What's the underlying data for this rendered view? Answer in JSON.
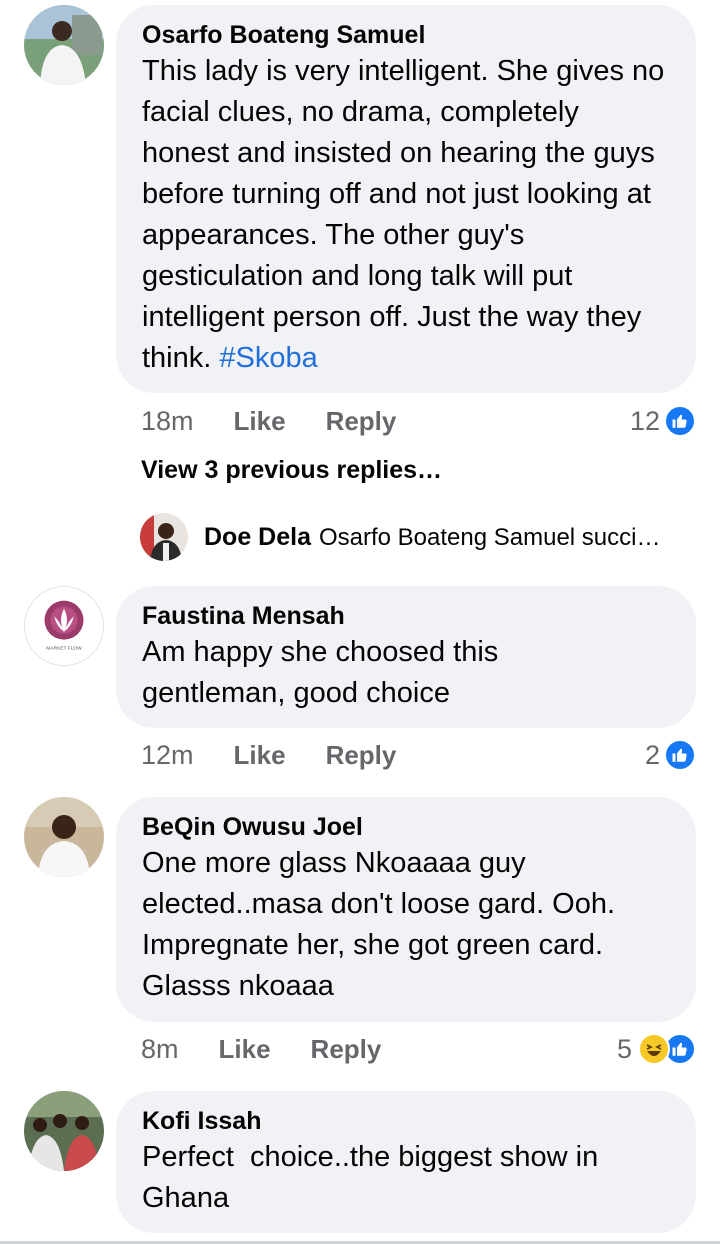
{
  "comments": [
    {
      "author": "Osarfo Boateng Samuel",
      "text": "This lady is very intelligent. She gives no facial clues, no drama, completely honest and insisted on hearing the guys before turning off and not just looking at appearances. The other guy's gesticulation and long talk will put intelligent person off. Just the way they think.",
      "hashtag": "#Skoba",
      "time": "18m",
      "like_label": "Like",
      "reply_label": "Reply",
      "reaction_count": "12"
    },
    {
      "author": "Faustina Mensah",
      "text": "Am happy she choosed this gentleman, good choice",
      "time": "12m",
      "like_label": "Like",
      "reply_label": "Reply",
      "reaction_count": "2"
    },
    {
      "author": "BeQin Owusu Joel",
      "text": "One more glass Nkoaaaa guy elected..masa don't loose gard. Ooh. Impregnate her, she got green card. Glasss nkoaaa",
      "time": "8m",
      "like_label": "Like",
      "reply_label": "Reply",
      "reaction_count": "5"
    },
    {
      "author": "Kofi Issah",
      "text": "Perfect  choice..the biggest show in Ghana"
    }
  ],
  "thread": {
    "view_previous_label": "View 3 previous replies…",
    "preview_author": "Doe Dela",
    "preview_text": "Osarfo Boateng Samuel succi…"
  },
  "faustina_avatar_logo_text": "MARKET FLOW",
  "colors": {
    "bubble": "#f0f2f5",
    "like_blue": "#1877f2",
    "hashtag": "#216fdb",
    "meta_gray": "#65676b"
  }
}
